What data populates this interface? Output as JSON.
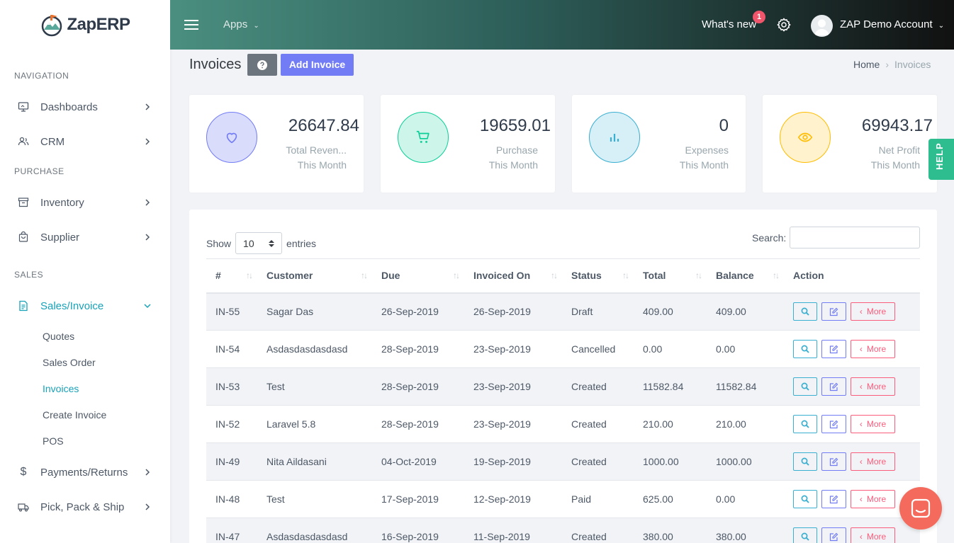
{
  "brand": {
    "name": "ZapERP"
  },
  "topbar": {
    "apps_label": "Apps",
    "whats_new": "What's new",
    "notification_count": "1",
    "account_name": "ZAP Demo Account"
  },
  "sidebar": {
    "sections": {
      "navigation": "NAVIGATION",
      "purchase": "PURCHASE",
      "sales": "SALES"
    },
    "items": {
      "dashboards": "Dashboards",
      "crm": "CRM",
      "inventory": "Inventory",
      "supplier": "Supplier",
      "sales_invoice": "Sales/Invoice",
      "payments_returns": "Payments/Returns",
      "pick_pack_ship": "Pick, Pack & Ship"
    },
    "sub_items": {
      "quotes": "Quotes",
      "sales_order": "Sales Order",
      "invoices": "Invoices",
      "create_invoice": "Create Invoice",
      "pos": "POS"
    }
  },
  "page": {
    "title": "Invoices",
    "add_button": "Add Invoice",
    "breadcrumb": {
      "home": "Home",
      "current": "Invoices"
    }
  },
  "stats": [
    {
      "value": "26647.84",
      "label": "Total Reven...",
      "period": "This Month",
      "icon": "heart-icon",
      "color": "#727cf5"
    },
    {
      "value": "19659.01",
      "label": "Purchase",
      "period": "This Month",
      "icon": "cart-icon",
      "color": "#0acf97"
    },
    {
      "value": "0",
      "label": "Expenses",
      "period": "This Month",
      "icon": "bar-chart-icon",
      "color": "#39afd1"
    },
    {
      "value": "69943.17",
      "label": "Net Profit",
      "period": "This Month",
      "icon": "eye-icon",
      "color": "#ffbc00"
    }
  ],
  "help_tab": "HELP",
  "table": {
    "show_label": "Show",
    "entries_label": "entries",
    "page_size": "10",
    "search_label": "Search:",
    "search_value": "",
    "columns": [
      "#",
      "Customer",
      "Due",
      "Invoiced On",
      "Status",
      "Total",
      "Balance",
      "Action"
    ],
    "more_label": "More",
    "rows": [
      [
        "IN-55",
        "Sagar Das",
        "26-Sep-2019",
        "26-Sep-2019",
        "Draft",
        "409.00",
        "409.00"
      ],
      [
        "IN-54",
        "Asdasdasdasdasd",
        "28-Sep-2019",
        "23-Sep-2019",
        "Cancelled",
        "0.00",
        "0.00"
      ],
      [
        "IN-53",
        "Test",
        "28-Sep-2019",
        "23-Sep-2019",
        "Created",
        "11582.84",
        "11582.84"
      ],
      [
        "IN-52",
        "Laravel 5.8",
        "28-Sep-2019",
        "23-Sep-2019",
        "Created",
        "210.00",
        "210.00"
      ],
      [
        "IN-49",
        "Nita Aildasani",
        "04-Oct-2019",
        "19-Sep-2019",
        "Created",
        "1000.00",
        "1000.00"
      ],
      [
        "IN-48",
        "Test",
        "17-Sep-2019",
        "12-Sep-2019",
        "Paid",
        "625.00",
        "0.00"
      ],
      [
        "IN-47",
        "Asdasdasdasdasd",
        "16-Sep-2019",
        "11-Sep-2019",
        "Created",
        "380.00",
        "380.00"
      ]
    ]
  }
}
